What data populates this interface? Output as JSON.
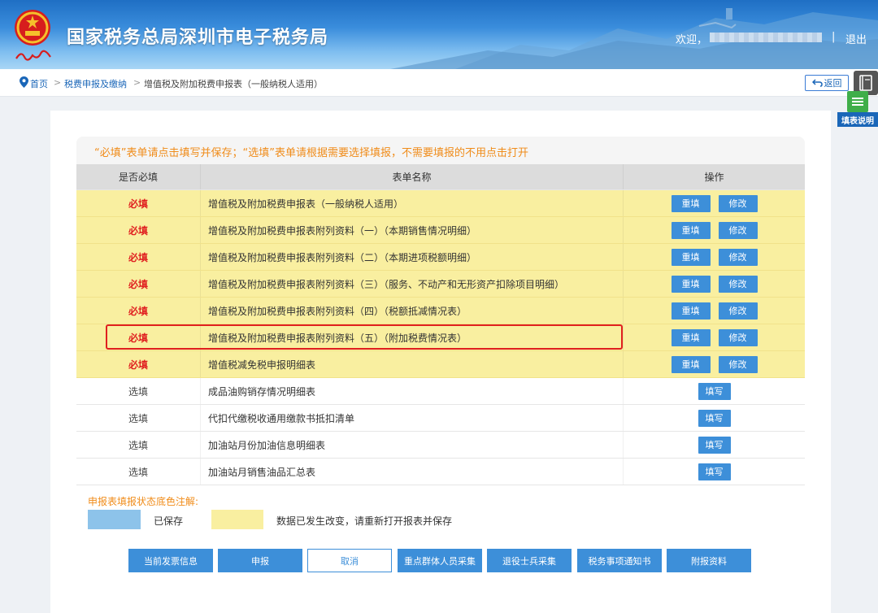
{
  "header": {
    "site_title": "国家税务总局深圳市电子税务局",
    "welcome": "欢迎，",
    "separator": "|",
    "logout": "退出"
  },
  "breadcrumb": {
    "home": "首页",
    "arrow": ">",
    "level2": "税费申报及缴纳",
    "current": "增值税及附加税费申报表（一般纳税人适用）"
  },
  "toolbar": {
    "back_label": "返回",
    "help_label": "填表说明"
  },
  "notice": "“必填”表单请点击填写并保存；“选填”表单请根据需要选择填报，不需要填报的不用点击打开",
  "table": {
    "headers": [
      "是否必填",
      "表单名称",
      "操作"
    ],
    "required_label": "必填",
    "optional_label": "选填",
    "refill_label": "重填",
    "modify_label": "修改",
    "fill_label": "填写",
    "rows": [
      {
        "type": "必填",
        "name": "增值税及附加税费申报表（一般纳税人适用）"
      },
      {
        "type": "必填",
        "name": "增值税及附加税费申报表附列资料（一）（本期销售情况明细）"
      },
      {
        "type": "必填",
        "name": "增值税及附加税费申报表附列资料（二）（本期进项税额明细）"
      },
      {
        "type": "必填",
        "name": "增值税及附加税费申报表附列资料（三）（服务、不动产和无形资产扣除项目明细）"
      },
      {
        "type": "必填",
        "name": "增值税及附加税费申报表附列资料（四）（税额抵减情况表）"
      },
      {
        "type": "必填",
        "name": "增值税及附加税费申报表附列资料（五）（附加税费情况表）"
      },
      {
        "type": "必填",
        "name": "增值税减免税申报明细表"
      },
      {
        "type": "选填",
        "name": "成品油购销存情况明细表"
      },
      {
        "type": "选填",
        "name": "代扣代缴税收通用缴款书抵扣清单"
      },
      {
        "type": "选填",
        "name": "加油站月份加油信息明细表"
      },
      {
        "type": "选填",
        "name": "加油站月销售油品汇总表"
      }
    ]
  },
  "legend": {
    "title": "申报表填报状态底色注解:",
    "saved": "已保存",
    "changed": "数据已发生改变，请重新打开报表并保存",
    "saved_color": "#8dc3ea",
    "changed_color": "#f9efa0"
  },
  "actions": {
    "invoice_info": "当前发票信息",
    "submit": "申报",
    "cancel": "取消",
    "key_group": "重点群体人员采集",
    "veteran": "退役士兵采集",
    "notice_doc": "税务事项通知书",
    "attachments": "附报资料"
  },
  "colors": {
    "accent": "#3d8fd9",
    "required_text": "#e02020",
    "notice_text": "#f08c1a",
    "highlight": "#e0201f"
  }
}
